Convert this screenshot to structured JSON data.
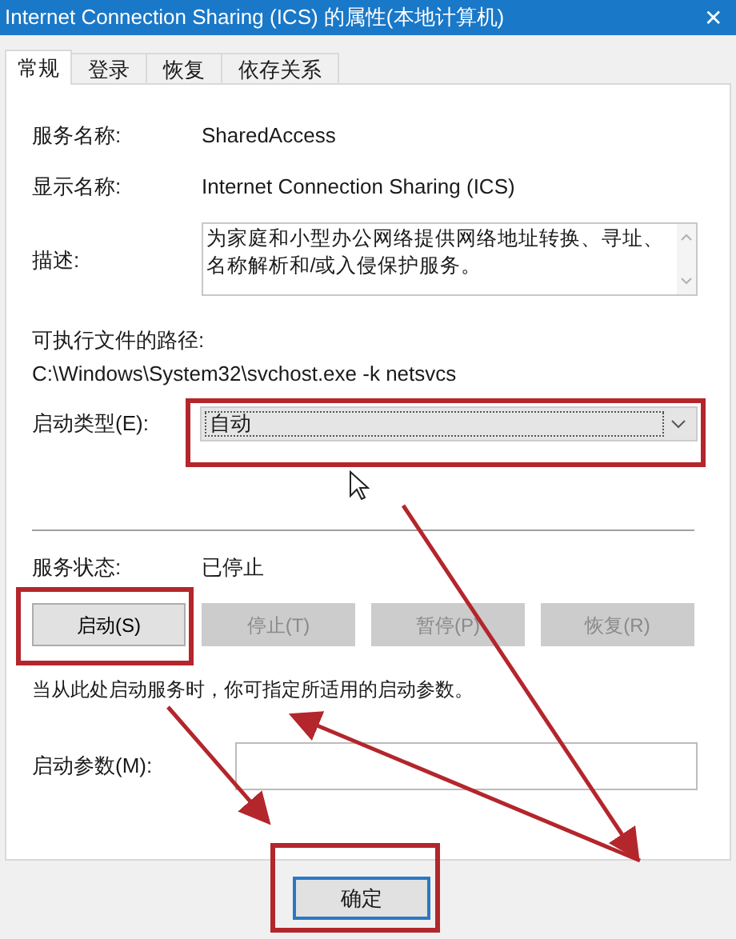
{
  "window": {
    "title": "Internet Connection Sharing (ICS) 的属性(本地计算机)",
    "close": "✕"
  },
  "tabs": [
    {
      "label": "常规",
      "selected": true
    },
    {
      "label": "登录",
      "selected": false
    },
    {
      "label": "恢复",
      "selected": false
    },
    {
      "label": "依存关系",
      "selected": false
    }
  ],
  "fields": [
    {
      "label": "服务名称:",
      "value": "SharedAccess"
    },
    {
      "label": "显示名称:",
      "value": "Internet Connection Sharing (ICS)"
    }
  ],
  "description": {
    "label": "描述:",
    "value": "为家庭和小型办公网络提供网络地址转换、寻址、名称解析和/或入侵保护服务。"
  },
  "path": {
    "label": "可执行文件的路径:",
    "value": "C:\\Windows\\System32\\svchost.exe -k netsvcs"
  },
  "startup_type": {
    "label": "启动类型(E):",
    "value": "自动",
    "focused": true,
    "highlighted": true
  },
  "service_status": {
    "label": "服务状态:",
    "value": "已停止"
  },
  "service_buttons": [
    {
      "label": "启动(S)",
      "disabled": false,
      "highlighted": true
    },
    {
      "label": "停止(T)",
      "disabled": true,
      "highlighted": false
    },
    {
      "label": "暂停(P)",
      "disabled": true,
      "highlighted": false
    },
    {
      "label": "恢复(R)",
      "disabled": true,
      "highlighted": false
    }
  ],
  "hint": "当从此处启动服务时，你可指定所适用的启动参数。",
  "start_parameters": {
    "label": "启动参数(M):"
  },
  "footer_buttons": [
    {
      "label": "确定",
      "default": true,
      "highlighted": true
    }
  ]
}
